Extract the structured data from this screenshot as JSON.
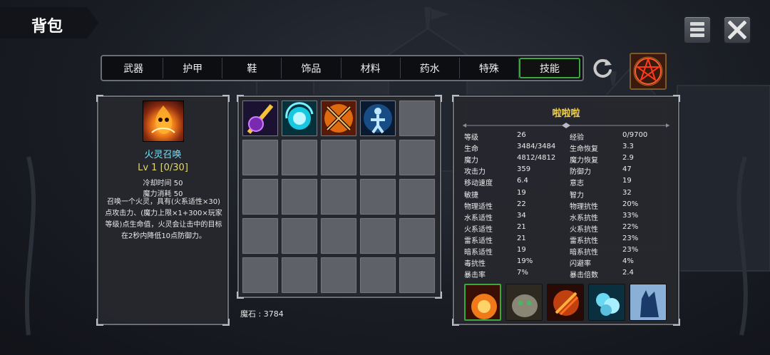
{
  "title": "背包",
  "tabs": [
    {
      "label": "武器",
      "active": false
    },
    {
      "label": "护甲",
      "active": false
    },
    {
      "label": "鞋",
      "active": false
    },
    {
      "label": "饰品",
      "active": false
    },
    {
      "label": "材料",
      "active": false
    },
    {
      "label": "药水",
      "active": false
    },
    {
      "label": "特殊",
      "active": false
    },
    {
      "label": "技能",
      "active": true
    }
  ],
  "skill": {
    "icon": "fire-spirit-icon",
    "name": "火灵召唤",
    "level": "Lv 1 [0/30]",
    "cooldown": "冷却时间 50",
    "mana_cost": "魔力消耗 50",
    "description": "召唤一个火灵，具有(火系适性×30)点攻击力、(魔力上限×1+300×玩家等级)点生命值，火灵会让击中的目标在2秒内降低10点防御力。"
  },
  "inventory": {
    "items": [
      "dark-orb-icon",
      "cyan-vortex-icon",
      "crossed-swords-icon",
      "blue-aura-figure-icon"
    ],
    "total_slots": 25
  },
  "mana_stone": "魔石 : 3784",
  "character": {
    "name": "啦啦啦",
    "stats": [
      {
        "label": "等级",
        "value": "26"
      },
      {
        "label": "经验",
        "value": "0/9700"
      },
      {
        "label": "生命",
        "value": "3484/3484"
      },
      {
        "label": "生命恢复",
        "value": "3.3"
      },
      {
        "label": "魔力",
        "value": "4812/4812"
      },
      {
        "label": "魔力恢复",
        "value": "2.9"
      },
      {
        "label": "攻击力",
        "value": "359"
      },
      {
        "label": "防御力",
        "value": "47"
      },
      {
        "label": "移动速度",
        "value": "6.4"
      },
      {
        "label": "意志",
        "value": "19"
      },
      {
        "label": "敏捷",
        "value": "19"
      },
      {
        "label": "智力",
        "value": "32"
      },
      {
        "label": "物理适性",
        "value": "22"
      },
      {
        "label": "物理抗性",
        "value": "20%"
      },
      {
        "label": "水系适性",
        "value": "34"
      },
      {
        "label": "水系抗性",
        "value": "33%"
      },
      {
        "label": "火系适性",
        "value": "21"
      },
      {
        "label": "火系抗性",
        "value": "22%"
      },
      {
        "label": "雷系适性",
        "value": "21"
      },
      {
        "label": "雷系抗性",
        "value": "23%"
      },
      {
        "label": "暗系适性",
        "value": "19"
      },
      {
        "label": "暗系抗性",
        "value": "23%"
      },
      {
        "label": "毒抗性",
        "value": "19%"
      },
      {
        "label": "闪避率",
        "value": "4%"
      },
      {
        "label": "暴击率",
        "value": "7%"
      },
      {
        "label": "暴击倍数",
        "value": "2.4"
      }
    ],
    "summons": [
      "fire-spirit-icon",
      "stone-golem-icon",
      "flame-claw-icon",
      "ice-crystal-icon",
      "shadow-wolf-icon"
    ]
  },
  "colors": {
    "active_tab_border": "#39a83f",
    "skill_name": "#6ee6ff",
    "skill_level": "#e2d670",
    "character_name": "#f2d24a"
  }
}
